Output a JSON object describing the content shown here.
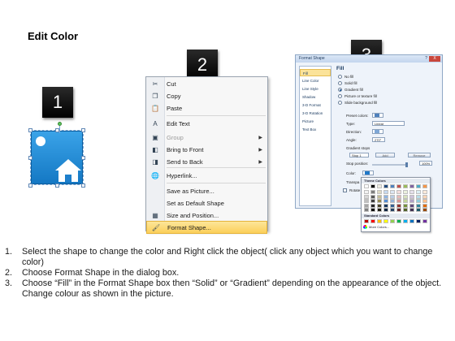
{
  "page": {
    "title": "Edit Color"
  },
  "steps": {
    "badge1": "1",
    "badge2": "2",
    "badge3": "3"
  },
  "context_menu": {
    "items": [
      {
        "label": "Cut",
        "icon": "scissors-icon",
        "glyph": "✂",
        "disabled": false,
        "submenu": false,
        "highlighted": false
      },
      {
        "label": "Copy",
        "icon": "copy-icon",
        "glyph": "❐",
        "disabled": false,
        "submenu": false,
        "highlighted": false
      },
      {
        "label": "Paste",
        "icon": "paste-icon",
        "glyph": "📋",
        "disabled": false,
        "submenu": false,
        "highlighted": false
      },
      {
        "label": "Edit Text",
        "icon": "edit-text-icon",
        "glyph": "A",
        "disabled": false,
        "submenu": false,
        "highlighted": false
      },
      {
        "label": "Group",
        "icon": "group-icon",
        "glyph": "▣",
        "disabled": true,
        "submenu": true,
        "highlighted": false
      },
      {
        "label": "Bring to Front",
        "icon": "bring-front-icon",
        "glyph": "◧",
        "disabled": false,
        "submenu": true,
        "highlighted": false
      },
      {
        "label": "Send to Back",
        "icon": "send-back-icon",
        "glyph": "◨",
        "disabled": false,
        "submenu": true,
        "highlighted": false
      },
      {
        "label": "Hyperlink...",
        "icon": "hyperlink-icon",
        "glyph": "🌐",
        "disabled": false,
        "submenu": false,
        "highlighted": false
      },
      {
        "label": "Save as Picture...",
        "icon": "",
        "glyph": "",
        "disabled": false,
        "submenu": false,
        "highlighted": false
      },
      {
        "label": "Set as Default Shape",
        "icon": "",
        "glyph": "",
        "disabled": false,
        "submenu": false,
        "highlighted": false
      },
      {
        "label": "Size and Position...",
        "icon": "size-position-icon",
        "glyph": "▦",
        "disabled": false,
        "submenu": false,
        "highlighted": false
      },
      {
        "label": "Format Shape...",
        "icon": "format-shape-icon",
        "glyph": "🖌",
        "disabled": false,
        "submenu": false,
        "highlighted": true
      }
    ]
  },
  "dialog": {
    "title": "Format Shape",
    "close_label": "X",
    "help_label": "?",
    "nav": [
      "Fill",
      "Line Color",
      "Line Style",
      "Shadow",
      "3-D Format",
      "3-D Rotation",
      "Picture",
      "Text Box"
    ],
    "panel_heading": "Fill",
    "fill_options": [
      {
        "label": "No fill",
        "checked": false
      },
      {
        "label": "Solid fill",
        "checked": false
      },
      {
        "label": "Gradient fill",
        "checked": true
      },
      {
        "label": "Picture or texture fill",
        "checked": false
      },
      {
        "label": "Slide background fill",
        "checked": false
      }
    ],
    "preset_colors_label": "Preset colors:",
    "type_label": "Type:",
    "type_value": "Linear",
    "direction_label": "Direction:",
    "angle_label": "Angle:",
    "angle_value": "270°",
    "gradient_stops_label": "Gradient stops",
    "stop_value": "Stop 1",
    "add_label": "Add",
    "remove_label": "Remove",
    "stop_position_label": "Stop position:",
    "stop_position_value": "100%",
    "color_label": "Color:",
    "transparency_label": "Transpa",
    "rotate_label": "Rotate"
  },
  "palette": {
    "theme_label": "Theme Colors",
    "standard_label": "Standard Colors",
    "more_label": "More Colors...",
    "theme_top": [
      "#ffffff",
      "#000000",
      "#eeece1",
      "#1f497d",
      "#4f81bd",
      "#c0504d",
      "#9bbb59",
      "#8064a2",
      "#4bacc6",
      "#f79646"
    ],
    "theme_shades": [
      [
        "#f2f2f2",
        "#7f7f7f",
        "#ddd9c3",
        "#c6d9f0",
        "#dbe5f1",
        "#f2dcdb",
        "#ebf1dd",
        "#e5e0ec",
        "#dbeef3",
        "#fdeada"
      ],
      [
        "#d8d8d8",
        "#595959",
        "#c4bd97",
        "#8db3e2",
        "#b8cce4",
        "#e5b9b7",
        "#d7e3bc",
        "#ccc1d9",
        "#b7dde8",
        "#fbd5b5"
      ],
      [
        "#bfbfbf",
        "#3f3f3f",
        "#938953",
        "#548dd4",
        "#95b3d7",
        "#d99694",
        "#c3d69b",
        "#b2a2c7",
        "#92cddc",
        "#fac08f"
      ],
      [
        "#a5a5a5",
        "#262626",
        "#494429",
        "#17365d",
        "#366092",
        "#953734",
        "#76923c",
        "#5f497a",
        "#31859b",
        "#e36c09"
      ],
      [
        "#7f7f7f",
        "#0c0c0c",
        "#1d1b10",
        "#0f243e",
        "#244061",
        "#632423",
        "#4f6128",
        "#3f3151",
        "#205867",
        "#974806"
      ]
    ],
    "standard": [
      "#c00000",
      "#ff0000",
      "#ffc000",
      "#ffff00",
      "#92d050",
      "#00b050",
      "#00b0f0",
      "#0070c0",
      "#002060",
      "#7030a0"
    ]
  },
  "instructions": [
    {
      "num": "1.",
      "text": "Select the shape to change the color and Right click the object( click any object which you want to change color)"
    },
    {
      "num": "2.",
      "text": "Choose Format Shape in the dialog box."
    },
    {
      "num": "3.",
      "text": "Choose “Fill” in the Format Shape box then “Solid” or “Gradient” depending on the appearance of the object. Change colour as shown in the picture."
    }
  ]
}
